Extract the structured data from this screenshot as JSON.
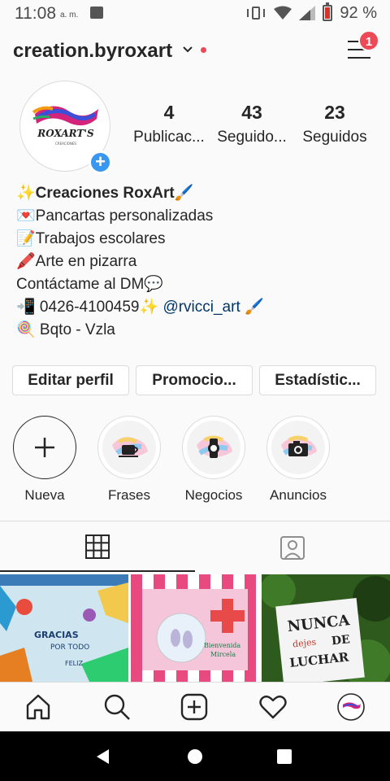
{
  "status_bar": {
    "time": "11:08",
    "ampm": "a. m.",
    "battery": "92 %"
  },
  "header": {
    "username": "creation.byroxart",
    "notification_count": "1"
  },
  "profile": {
    "avatar_text": "ROXART'S",
    "avatar_subtext": "CREACIONES",
    "stats": [
      {
        "value": "4",
        "label": "Publicac..."
      },
      {
        "value": "43",
        "label": "Seguido..."
      },
      {
        "value": "23",
        "label": "Seguidos"
      }
    ]
  },
  "bio": {
    "name": "✨Creaciones RoxArt🖌️",
    "lines": [
      "💌Pancartas personalizadas",
      "📝Trabajos escolares",
      "🖍️Arte en pizarra",
      "Contáctame al DM💬"
    ],
    "phone": "📲 0426-4100459✨",
    "mention": "@rvicci_art",
    "mention_suffix": " 🖌️",
    "location": "🍭 Bqto - Vzla"
  },
  "buttons": {
    "edit": "Editar perfil",
    "promo": "Promocio...",
    "stats": "Estadístic..."
  },
  "highlights": [
    {
      "label": "Nueva",
      "icon": "plus-icon"
    },
    {
      "label": "Frases",
      "icon": "coffee-cup-icon"
    },
    {
      "label": "Negocios",
      "icon": "watch-icon"
    },
    {
      "label": "Anuncios",
      "icon": "camera-icon"
    }
  ],
  "tabs": [
    {
      "name": "grid",
      "icon": "grid-icon",
      "active": true
    },
    {
      "name": "tagged",
      "icon": "tagged-person-icon",
      "active": false
    }
  ],
  "posts": [
    {
      "caption": "GRACIAS POR TODO · FELIZ",
      "theme": "chalkboard-art"
    },
    {
      "caption": "Bienvenida Mircelis",
      "theme": "baby-banner"
    },
    {
      "caption": "NUNCA dejes DE LUCHAR",
      "theme": "motivational-card"
    }
  ],
  "bottom_nav": [
    "home-icon",
    "search-icon",
    "new-post-icon",
    "activity-heart-icon",
    "profile-avatar-icon"
  ],
  "colors": {
    "accent_blue": "#3897f0",
    "badge_red": "#ed4956",
    "link_blue": "#003569",
    "text": "#262626",
    "border": "#dbdbdb"
  }
}
